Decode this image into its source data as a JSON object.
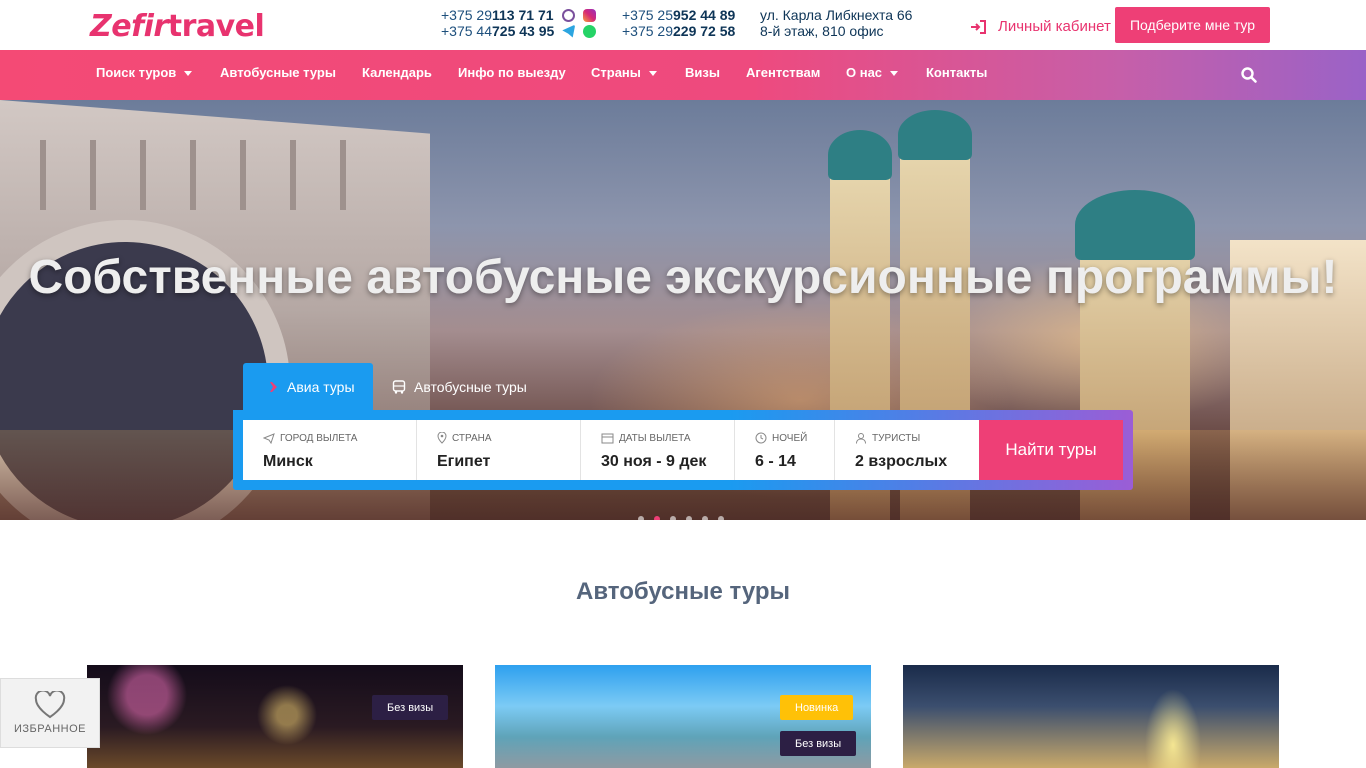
{
  "header": {
    "logo_text_a": "Zefir",
    "logo_text_b": " travel",
    "phones_col1": [
      {
        "prefix": "+375 29 ",
        "number": "113 71 71"
      },
      {
        "prefix": "+375 44 ",
        "number": "725 43 95"
      }
    ],
    "phones_col2": [
      {
        "prefix": "+375 25 ",
        "number": "952 44 89"
      },
      {
        "prefix": "+375 29 ",
        "number": "229 72 58"
      }
    ],
    "address_line1": "ул. Карла Либкнехта 66",
    "address_line2": "8-й этаж, 810 офис",
    "cabinet_label": "Личный кабинет",
    "pick_tour_label": "Подберите мне тур",
    "messenger_icons": [
      "viber-icon",
      "instagram-icon",
      "telegram-icon",
      "whatsapp-icon"
    ],
    "colors": {
      "brand": "#ee3f76",
      "dark_blue": "#0e3557",
      "accent_blue": "#1a9bf0"
    }
  },
  "nav": {
    "items": [
      {
        "label": "Поиск туров",
        "has_dropdown": true
      },
      {
        "label": "Автобусные туры",
        "has_dropdown": false
      },
      {
        "label": "Календарь",
        "has_dropdown": false
      },
      {
        "label": "Инфо по выезду",
        "has_dropdown": false
      },
      {
        "label": "Страны",
        "has_dropdown": true
      },
      {
        "label": "Визы",
        "has_dropdown": false
      },
      {
        "label": "Агентствам",
        "has_dropdown": false
      },
      {
        "label": "О нас",
        "has_dropdown": true
      },
      {
        "label": "Контакты",
        "has_dropdown": false
      }
    ]
  },
  "hero": {
    "title": "Собственные автобусные экскурсионные программы!",
    "slider_active_index": 1,
    "slider_count": 6
  },
  "search": {
    "tabs": [
      {
        "label": "Авиа туры",
        "icon": "plane-icon",
        "active": true
      },
      {
        "label": "Автобусные туры",
        "icon": "bus-icon",
        "active": false
      }
    ],
    "fields": [
      {
        "label": "Город вылета",
        "value": "Минск",
        "icon": "plane-icon"
      },
      {
        "label": "Страна",
        "value": "Египет",
        "icon": "location-pin-icon"
      },
      {
        "label": "Даты вылета",
        "value": "30 ноя - 9 дек",
        "icon": "calendar-icon"
      },
      {
        "label": "Ночей",
        "value": "6 - 14",
        "icon": "clock-icon"
      },
      {
        "label": "Туристы",
        "value": "2 взрослых",
        "icon": "person-icon"
      }
    ],
    "submit_label": "Найти туры"
  },
  "bus_tours": {
    "section_title": "Автобусные туры",
    "cards": [
      {
        "badges": [
          "Без визы"
        ]
      },
      {
        "badges": [
          "Новинка",
          "Без визы"
        ]
      },
      {
        "badges": []
      }
    ]
  },
  "favorites": {
    "label": "ИЗБРАННОЕ"
  }
}
